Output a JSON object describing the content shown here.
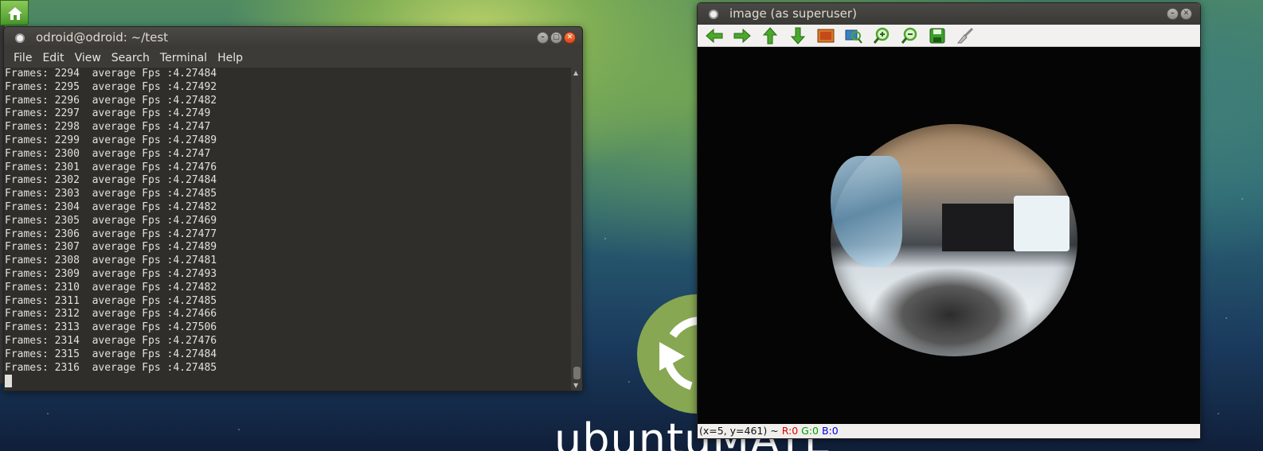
{
  "terminal": {
    "title": "odroid@odroid: ~/test",
    "menu": [
      "File",
      "Edit",
      "View",
      "Search",
      "Terminal",
      "Help"
    ],
    "lines": [
      "Frames: 2294  average Fps :4.27484",
      "Frames: 2295  average Fps :4.27492",
      "Frames: 2296  average Fps :4.27482",
      "Frames: 2297  average Fps :4.2749",
      "Frames: 2298  average Fps :4.2747",
      "Frames: 2299  average Fps :4.27489",
      "Frames: 2300  average Fps :4.2747",
      "Frames: 2301  average Fps :4.27476",
      "Frames: 2302  average Fps :4.27484",
      "Frames: 2303  average Fps :4.27485",
      "Frames: 2304  average Fps :4.27482",
      "Frames: 2305  average Fps :4.27469",
      "Frames: 2306  average Fps :4.27477",
      "Frames: 2307  average Fps :4.27489",
      "Frames: 2308  average Fps :4.27481",
      "Frames: 2309  average Fps :4.27493",
      "Frames: 2310  average Fps :4.27482",
      "Frames: 2311  average Fps :4.27485",
      "Frames: 2312  average Fps :4.27466",
      "Frames: 2313  average Fps :4.27506",
      "Frames: 2314  average Fps :4.27476",
      "Frames: 2315  average Fps :4.27484",
      "Frames: 2316  average Fps :4.27485"
    ]
  },
  "image_window": {
    "title": "image (as superuser)",
    "toolbar_icons": [
      "arrow-left-icon",
      "arrow-right-icon",
      "arrow-up-icon",
      "arrow-down-icon",
      "picture-icon",
      "zoom-fit-icon",
      "zoom-in-icon",
      "zoom-out-icon",
      "save-icon",
      "brush-icon"
    ],
    "status": {
      "coords": "(x=5, y=461) ~ ",
      "r": "R:0",
      "g": "G:0",
      "b": "B:0"
    }
  },
  "desktop": {
    "wallpaper_text": "ubuntuMATE"
  },
  "colors": {
    "accent_green": "#5aa02c",
    "terminal_bg": "#2f2e2a",
    "close_orange": "#e0531f"
  }
}
